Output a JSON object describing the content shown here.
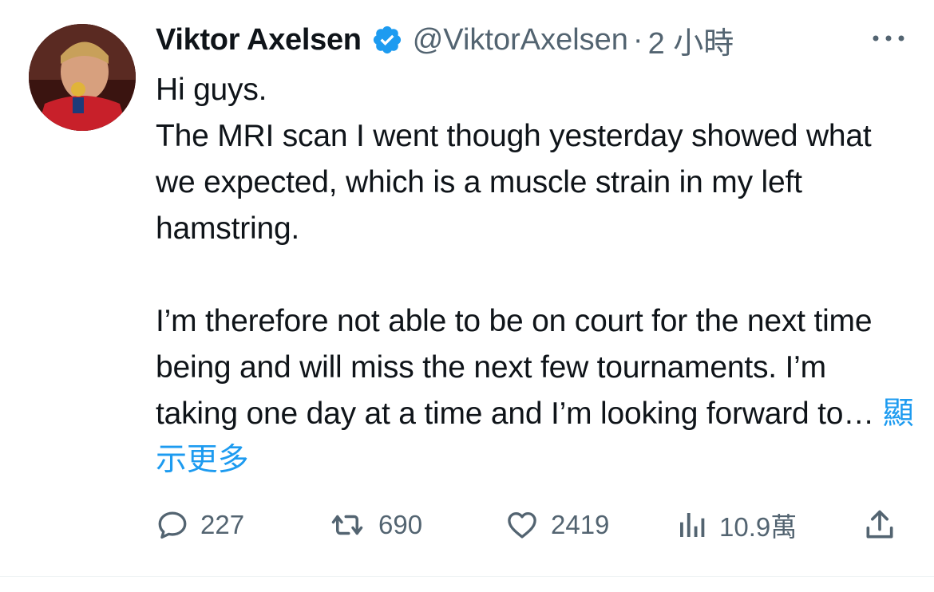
{
  "tweet": {
    "author": {
      "display_name": "Viktor Axelsen",
      "handle": "@ViktorAxelsen",
      "verified_icon": "verified-badge-icon",
      "avatar_icon": "avatar"
    },
    "separator": "·",
    "time": "2 小時",
    "more_icon": "more-horizontal-icon",
    "text": {
      "line1": "Hi guys.",
      "para1": "The MRI scan I went though yesterday showed what we expected, which is a muscle strain in my left hamstring.",
      "para2": " I’m therefore not able to be on court for the next time being and will miss the next few tournaments. I’m taking one day at a time and I’m looking forward to… ",
      "show_more": "顯示更多"
    },
    "actions": {
      "reply": {
        "icon": "reply-icon",
        "count": "227"
      },
      "retweet": {
        "icon": "retweet-icon",
        "count": "690"
      },
      "like": {
        "icon": "heart-icon",
        "count": "2419"
      },
      "views": {
        "icon": "views-chart-icon",
        "count": "10.9萬"
      },
      "share": {
        "icon": "share-icon"
      }
    },
    "colors": {
      "text": "#0f1419",
      "secondary": "#536471",
      "accent": "#1d9bf0"
    }
  }
}
